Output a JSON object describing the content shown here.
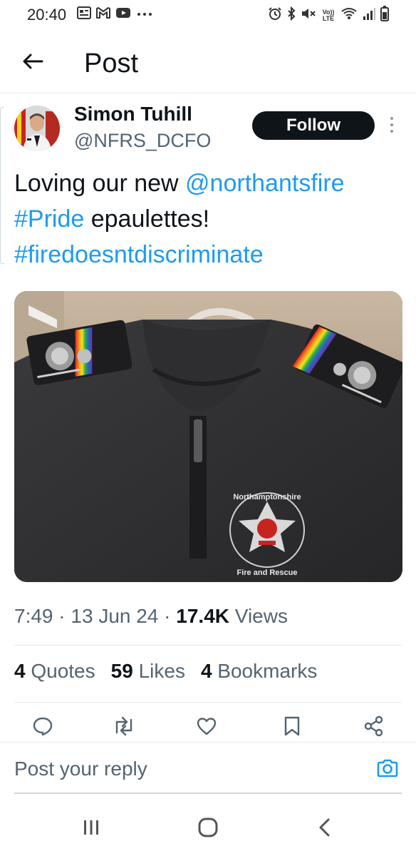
{
  "status_bar": {
    "time": "20:40",
    "left_icons": [
      "gallery-icon",
      "gmail-icon",
      "youtube-icon",
      "more-dots-icon"
    ],
    "right_icons": [
      "alarm-icon",
      "bluetooth-icon",
      "mute-icon",
      "volte-icon",
      "wifi-icon",
      "signal-icon",
      "battery-icon"
    ],
    "volte_label": "Vo)) LTE"
  },
  "header": {
    "title": "Post",
    "back_icon": "arrow-left-icon"
  },
  "post": {
    "author": {
      "display_name": "Simon Tuhill",
      "handle": "@NFRS_DCFO"
    },
    "follow_label": "Follow",
    "text": {
      "part1": "Loving our new ",
      "mention": "@northantsfire",
      "hashtag1": "#Pride",
      "part2": " epaulettes!",
      "hashtag2": "#firedoesntdiscriminate"
    },
    "media": {
      "badge_text_top": "Northamptonshire",
      "badge_text_bottom": "Fire and Rescue"
    },
    "meta": {
      "time": "7:49",
      "sep1": " · ",
      "date": "13 Jun 24",
      "sep2": " · ",
      "views_count": "17.4K",
      "views_label": " Views"
    },
    "stats": {
      "quotes_count": "4",
      "quotes_label": " Quotes",
      "likes_count": "59",
      "likes_label": " Likes",
      "bookmarks_count": "4",
      "bookmarks_label": " Bookmarks"
    },
    "actions": [
      "reply-icon",
      "repost-icon",
      "like-icon",
      "bookmark-icon",
      "share-icon"
    ]
  },
  "reply": {
    "placeholder": "Post your reply"
  },
  "colors": {
    "link": "#1d9bf0",
    "text": "#0f1419",
    "secondary": "#536471",
    "follow_bg": "#0f1419"
  }
}
